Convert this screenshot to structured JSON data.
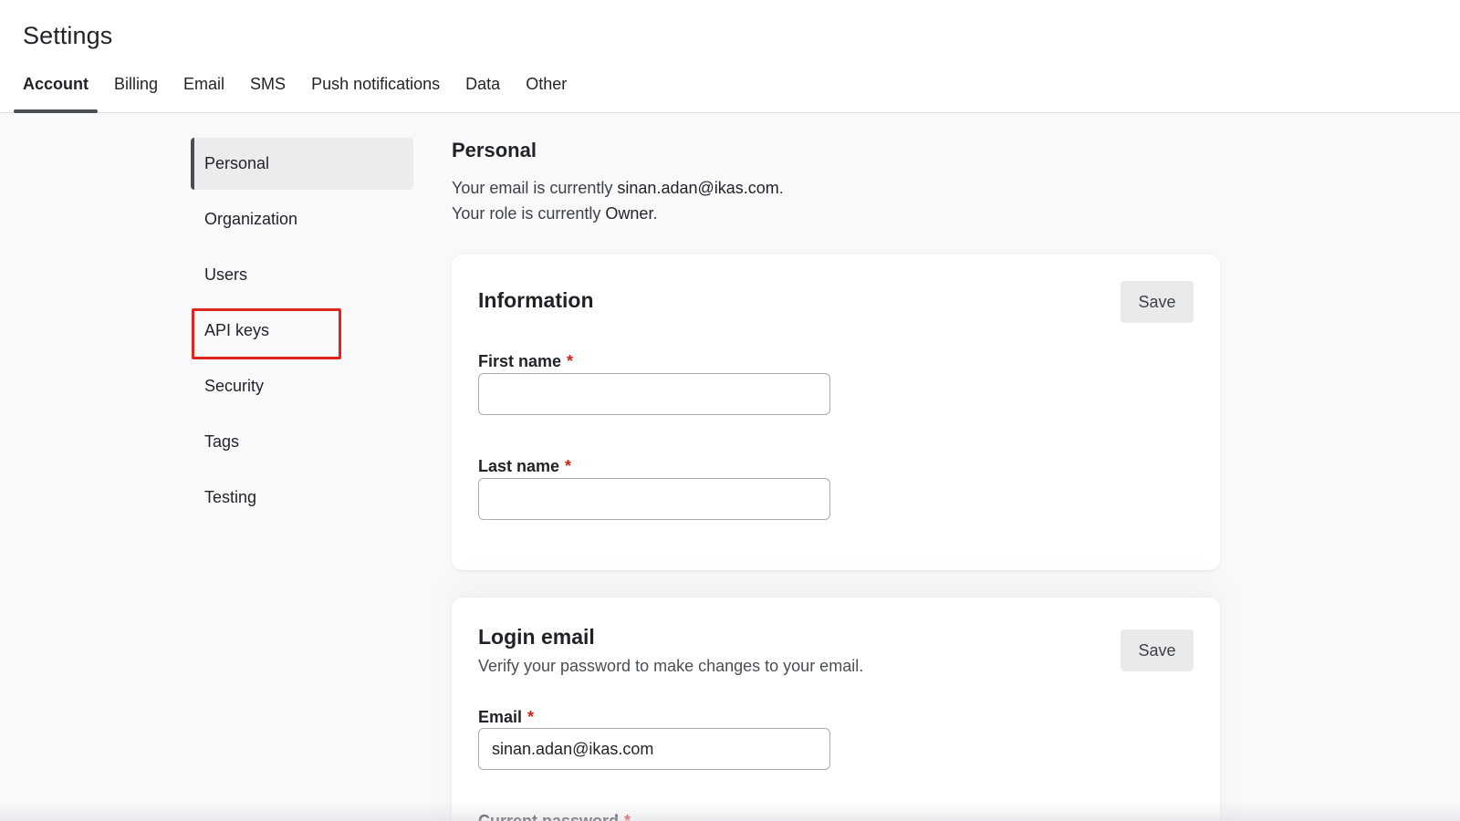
{
  "page": {
    "title": "Settings"
  },
  "tabs": [
    {
      "label": "Account",
      "active": true
    },
    {
      "label": "Billing"
    },
    {
      "label": "Email"
    },
    {
      "label": "SMS"
    },
    {
      "label": "Push notifications"
    },
    {
      "label": "Data"
    },
    {
      "label": "Other"
    }
  ],
  "sidebar": {
    "items": [
      {
        "label": "Personal",
        "active": true
      },
      {
        "label": "Organization"
      },
      {
        "label": "Users"
      },
      {
        "label": "API keys",
        "highlighted": true
      },
      {
        "label": "Security"
      },
      {
        "label": "Tags"
      },
      {
        "label": "Testing"
      }
    ]
  },
  "personal": {
    "title": "Personal",
    "email_prefix": "Your email is currently ",
    "email_value": "sinan.adan@ikas.com",
    "email_suffix": ".",
    "role_prefix": "Your role is currently ",
    "role_value": "Owner",
    "role_suffix": "."
  },
  "information_card": {
    "title": "Information",
    "save_label": "Save",
    "first_name_label": "First name",
    "first_name_value": "",
    "last_name_label": "Last name",
    "last_name_value": "",
    "required_mark": "*"
  },
  "login_card": {
    "title": "Login email",
    "subtitle": "Verify your password to make changes to your email.",
    "save_label": "Save",
    "email_label": "Email",
    "email_value": "sinan.adan@ikas.com",
    "password_label": "Current password",
    "required_mark": "*"
  },
  "colors": {
    "highlight": "#e0261c",
    "required": "#d02316",
    "active_indicator": "#4a4d52"
  }
}
